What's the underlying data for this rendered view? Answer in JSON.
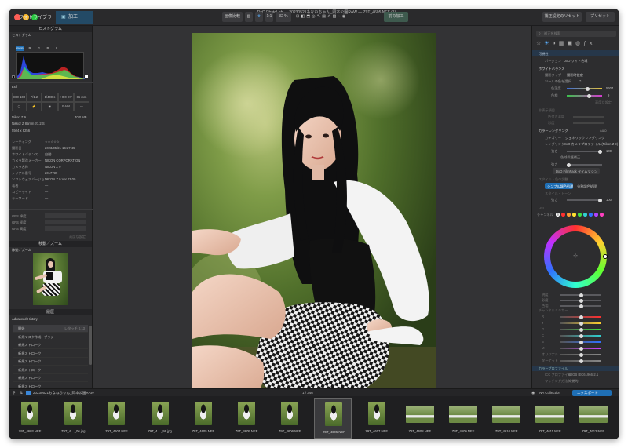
{
  "title": "DxO PhotoLab — 20230521もなねちゃん_岡本公園RAW — Z9T_4605.NEF (1)",
  "tabs": {
    "library": "フォトライブラリ",
    "customize": "加工"
  },
  "toolbar": {
    "compare": "画像比較",
    "zoom_ratio": "1:1",
    "zoom_pct": "32 %",
    "apply_preset": "前の加工",
    "reset": "補正設定のリセット",
    "preset": "プリセット"
  },
  "left_panel": {
    "histogram_header": "ヒストグラム",
    "histogram_title": "ヒストグラム",
    "channels": [
      "RGB",
      "R",
      "G",
      "B",
      "L"
    ],
    "exif_title": "Exif",
    "exif_values": [
      "ISO 100",
      "ƒ/1.2",
      "1/400 s",
      "+0.0 EV",
      "85 mm"
    ],
    "exif_icons": [
      "▢",
      "⚡",
      "◉",
      "RAW",
      "▭"
    ],
    "camera": "Nikon Z 9",
    "lens": "Nikkor Z 85mm f/1.2 S",
    "file_size": "40.0 MB",
    "resolution": "5504 x 8256",
    "meta_rows": [
      {
        "label": "レーティング",
        "value": "☆☆☆☆☆"
      },
      {
        "label": "撮影日",
        "value": "2023/05/21 16:27:45"
      },
      {
        "label": "ホワイトバランス",
        "value": "自動"
      },
      {
        "label": "カメラ製造メーカー",
        "value": "NIKON CORPORATION"
      },
      {
        "label": "カメラ名称",
        "value": "NIKON Z 9"
      },
      {
        "label": "シリアル番号",
        "value": "2017739"
      },
      {
        "label": "ソフトウェアバージョン",
        "value": "NIKON Z 9 Ver.03.00"
      },
      {
        "label": "著者",
        "value": "—"
      },
      {
        "label": "コピーライト",
        "value": "—"
      },
      {
        "label": "キーワード",
        "value": "—"
      }
    ],
    "gps_rows": [
      "GPS 緯度",
      "GPS 経度",
      "GPS 高度"
    ],
    "gps_more": "高度な設定",
    "nav_header": "移動／ズーム",
    "nav_title": "移動／ズーム",
    "history_header": "履歴",
    "history_title": "Advanced History",
    "history_items": [
      {
        "label": "開始",
        "value": "レタッチ 0.13"
      },
      {
        "label": "新規マスク作成 - ブラシ",
        "value": ""
      },
      {
        "label": "新規ストローク",
        "value": ""
      },
      {
        "label": "新規ストローク",
        "value": ""
      },
      {
        "label": "新規ストローク",
        "value": ""
      },
      {
        "label": "新規ストローク",
        "value": ""
      },
      {
        "label": "新規ストローク",
        "value": ""
      },
      {
        "label": "新規ストローク",
        "value": ""
      },
      {
        "label": "新規ストローク",
        "value": ""
      },
      {
        "label": "新規ストローク",
        "value": ""
      }
    ]
  },
  "right_panel": {
    "search_placeholder": "補正を検索",
    "camera_header": "可視性",
    "version_label": "バージョン",
    "version_value": "DxO ワイド色域",
    "wb_header": "ホワイトバランス",
    "wb_type_label": "撮影タイプ",
    "wb_type_value": "撮影時設定",
    "wb_picker": "ツールの色を選択",
    "temp_label": "色温度",
    "temp_value": "5604",
    "tint_label": "色相",
    "tint_value": "9",
    "wb_more": "高度な設定",
    "faded_header": "非表示項目",
    "faded_rows": [
      "色付き温度",
      "彩度"
    ],
    "color_render_header": "カラーレンダリング",
    "color_render_mode": "Auto",
    "category_label": "カテゴリー",
    "category_value": "ジェネリックレンダリング",
    "rendering_label": "レンダリング",
    "rendering_value": "DxO カメラプロファイル (Nikon Z 9)",
    "intensity_label": "強さ",
    "intensity_value": "100",
    "protect_label": "色域保護補正",
    "protect_value": "強さ",
    "filmpack": "DxO FilmPack タイムマシン",
    "style_header": "スタイル・色の調整",
    "simple": "シンプル調色処理",
    "split": "分割調色処理",
    "style_row": "スタイル・トーン",
    "style_strength": "強さ",
    "style_strength_value": "100",
    "hsl_header": "HSL",
    "channel_label": "チャンネル",
    "hsl_rows": [
      "明度",
      "彩度",
      "色相"
    ],
    "mixer_header": "チャンネルミキサー",
    "mixer_rows": [
      "R",
      "Y",
      "G",
      "C",
      "B",
      "M",
      "オリジナル",
      "ターゲット"
    ],
    "profile_header": "カラープロファイル",
    "icc_label": "ICC プロファイル",
    "icc_value": "sRGB IEC61966-2.1",
    "intent_label": "マッチング方法",
    "intent_value": "知覚的",
    "softproof": "ソフトプルーフモード"
  },
  "filmstrip": {
    "folder": "20230521もなねちゃん_岡本公園RAW",
    "count": "1 / 346",
    "collection_label": "NA Collection",
    "export_label": "エクスポート",
    "items": [
      {
        "name": "Z9T_4603.NEF",
        "kind": "portrait"
      },
      {
        "name": "Z9T_4... _06.jpg",
        "kind": "portrait"
      },
      {
        "name": "Z9T_4604.NEF",
        "kind": "portrait"
      },
      {
        "name": "Z9T_4... _99.jpg",
        "kind": "portrait"
      },
      {
        "name": "Z9T_4605.NEF",
        "kind": "portrait"
      },
      {
        "name": "Z9T_4605.NEF",
        "kind": "portrait"
      },
      {
        "name": "Z9T_4606.NEF",
        "kind": "portrait"
      },
      {
        "name": "Z9T_4605.NEF",
        "kind": "selected"
      },
      {
        "name": "Z9T_4607.NEF",
        "kind": "portrait"
      },
      {
        "name": "Z9T_4608.NEF",
        "kind": "landscape"
      },
      {
        "name": "Z9T_4609.NEF",
        "kind": "landscape"
      },
      {
        "name": "Z9T_4610.NEF",
        "kind": "landscape"
      },
      {
        "name": "Z9T_4611.NEF",
        "kind": "landscape"
      },
      {
        "name": "Z9T_4612.NEF",
        "kind": "landscape"
      }
    ]
  },
  "colors": {
    "accent": "#1f6fb5",
    "active_tab": "#234a66",
    "panel": "#2d2d2f"
  }
}
